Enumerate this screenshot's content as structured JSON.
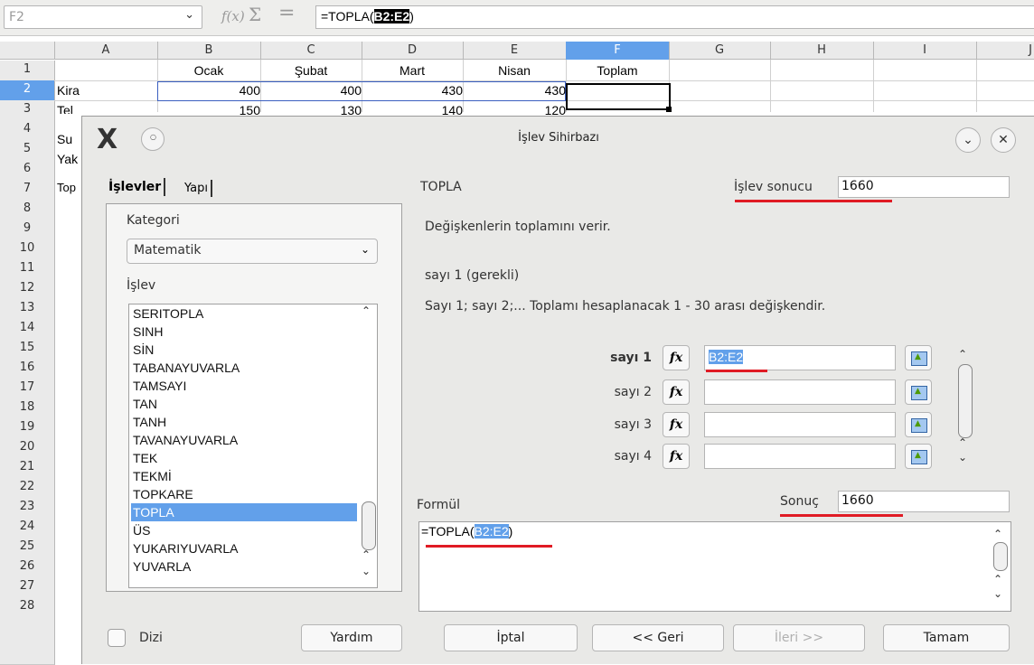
{
  "formula_bar": {
    "cell_ref": "F2",
    "namebox_arrow": "⌵",
    "fx_icon": "f(x)",
    "sum_icon": "Σ",
    "equals_icon": "=",
    "formula_prefix": "=TOPLA(",
    "formula_highlight": "B2:E2",
    "formula_suffix": ")"
  },
  "sheet": {
    "columns": [
      "A",
      "B",
      "C",
      "D",
      "E",
      "F",
      "G",
      "H",
      "I",
      "J"
    ],
    "selected_column": "F",
    "rows": [
      "1",
      "2",
      "3",
      "4",
      "5",
      "6",
      "7",
      "8",
      "9",
      "10",
      "11",
      "12",
      "13",
      "14",
      "15",
      "16",
      "17",
      "18",
      "19",
      "20",
      "21",
      "22",
      "23",
      "24",
      "25",
      "26",
      "27",
      "28"
    ],
    "selected_row": "2",
    "headers": [
      "Ocak",
      "Şubat",
      "Mart",
      "Nisan",
      "Toplam"
    ],
    "row2": {
      "label": "Kira",
      "values": [
        "400",
        "400",
        "430",
        "430"
      ]
    },
    "row3": {
      "label": "Tel",
      "values": [
        "150",
        "130",
        "140",
        "120"
      ]
    },
    "partial_labels": [
      "Su",
      "Yak",
      "Top"
    ]
  },
  "dialog": {
    "title": "İşlev Sihirbazı",
    "logo": "X",
    "tabs": [
      "İşlevler",
      "Yapı"
    ],
    "category_label": "Kategori",
    "category_value": "Matematik",
    "function_label": "İşlev",
    "functions": [
      "SERITOPLA",
      "SINH",
      "SİN",
      "TABANAYUVARLA",
      "TAMSAYI",
      "TAN",
      "TANH",
      "TAVANAYUVARLA",
      "TEK",
      "TEKMİ",
      "TOPKARE",
      "TOPLA",
      "ÜS",
      "YUKARIYUVARLA",
      "YUVARLA"
    ],
    "selected_function": "TOPLA",
    "function_name": "TOPLA",
    "result_label": "İşlev sonucu",
    "result_value": "1660",
    "description": "Değişkenlerin toplamını verir.",
    "param_title": "sayı 1 (gerekli)",
    "param_description": "Sayı 1; sayı 2;... Toplamı hesaplanacak 1 - 30 arası değişkendir.",
    "args": [
      {
        "label": "sayı 1",
        "value": "B2:E2"
      },
      {
        "label": "sayı 2",
        "value": ""
      },
      {
        "label": "sayı 3",
        "value": ""
      },
      {
        "label": "sayı 4",
        "value": ""
      }
    ],
    "fx_glyph": "fx",
    "formula_label": "Formül",
    "sonuc_label": "Sonuç",
    "sonuc_value": "1660",
    "formula_prefix": "=TOPLA(",
    "formula_highlight": "B2:E2",
    "formula_suffix": ")",
    "array_label": "Dizi",
    "buttons": {
      "help": "Yardım",
      "cancel": "İptal",
      "back": "<< Geri",
      "next": "İleri >>",
      "ok": "Tamam"
    }
  },
  "colors": {
    "selection": "#62a0ea",
    "annotation": "#e01b24",
    "dialog_bg": "#e9e9e7"
  }
}
